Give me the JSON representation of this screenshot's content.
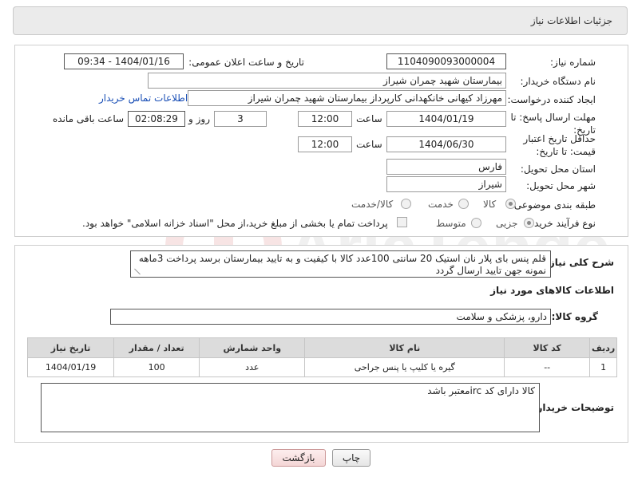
{
  "header": {
    "title": "جزئیات اطلاعات نیاز"
  },
  "form": {
    "need_number": {
      "label": "شماره نیاز:",
      "value": "1104090093000004"
    },
    "announce_datetime": {
      "label": "تاریخ و ساعت اعلان عمومی:",
      "value": "1404/01/16 - 09:34"
    },
    "buyer_org": {
      "label": "نام دستگاه خریدار:",
      "value": "بیمارستان شهید چمران شیراز"
    },
    "requester": {
      "label": "ایجاد کننده درخواست:",
      "value": "مهرزاد کیهانی خانکهدانی کارپرداز بیمارستان شهید چمران شیراز"
    },
    "contact_link": "اطلاعات تماس خریدار",
    "reply_deadline": {
      "label": "مهلت ارسال پاسخ: تا تاریخ:",
      "date": "1404/01/19",
      "time_label": "ساعت",
      "time": "12:00",
      "days": "3",
      "days_label": "روز و",
      "remaining": "02:08:29",
      "remaining_label": "ساعت باقی مانده"
    },
    "price_validity": {
      "label": "حداقل تاریخ اعتبار قیمت: تا تاریخ:",
      "date": "1404/06/30",
      "time_label": "ساعت",
      "time": "12:00"
    },
    "province": {
      "label": "استان محل تحویل:",
      "value": "فارس"
    },
    "city": {
      "label": "شهر محل تحویل:",
      "value": "شیراز"
    },
    "category": {
      "label": "طبقه بندی موضوعی:",
      "options": [
        "کالا",
        "خدمت",
        "کالا/خدمت"
      ],
      "selected": "کالا"
    },
    "purchase_type": {
      "label": "نوع فرآیند خرید :",
      "options": [
        "جزیی",
        "متوسط"
      ],
      "selected": "جزیی",
      "treasury_note": "پرداخت تمام یا بخشی از مبلغ خرید،از محل \"اسناد خزانه اسلامی\" خواهد بود."
    }
  },
  "description": {
    "label": "شرح کلی نیاز:",
    "text": "قلم پنس بای پلار نان استیک 20 سانتی 100عدد کالا با کیفیت و به تایید بیمارستان برسد پرداخت 3ماهه نمونه جهن تایید ارسال گردد"
  },
  "goods_section": {
    "title": "اطلاعات کالاهای مورد نیاز",
    "group_label": "گروه کالا:",
    "group_value": "دارو، پزشکی و سلامت",
    "columns": [
      "ردیف",
      "کد کالا",
      "نام کالا",
      "واحد شمارش",
      "تعداد / مقدار",
      "تاریخ نیاز"
    ],
    "rows": [
      {
        "row": "1",
        "code": "--",
        "name": "گیره یا کلیپ یا پنس جراحی",
        "unit": "عدد",
        "qty": "100",
        "date": "1404/01/19"
      }
    ]
  },
  "buyer_notes": {
    "label": "توضیحات خریدار:",
    "text": "کالا دارای کد ircمعتبر باشد"
  },
  "buttons": {
    "print": "چاپ",
    "back": "بازگشت"
  },
  "watermark_text": "AriaTender.net"
}
